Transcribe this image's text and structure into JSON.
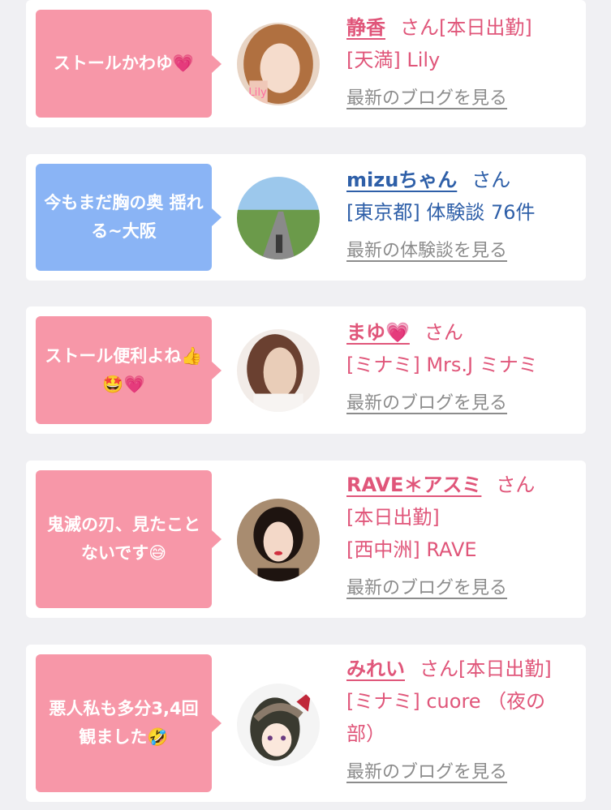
{
  "cards": [
    {
      "message": "ストールかわゆ💗",
      "name": "静香",
      "san": "さん[本日出勤]",
      "lines": [
        "[天満] Lily"
      ],
      "link": "最新のブログを見る",
      "color": "#f797a8"
    },
    {
      "message": "今もまだ胸の奥 揺れる~大阪",
      "name": "mizuちゃん",
      "san": "さん",
      "lines": [
        "[東京都] 体験談 76件"
      ],
      "link": "最新の体験談を見る",
      "color": "#8ab4f5"
    },
    {
      "message": "ストール便利よね👍🤩💗",
      "name": "まゆ💗",
      "san": "さん",
      "lines": [
        "[ミナミ] Mrs.J ミナミ"
      ],
      "link": "最新のブログを見る",
      "color": "#f797a8"
    },
    {
      "message": "鬼滅の刃、見たことないです😅",
      "name": "RAVE＊アスミ",
      "san": "さん",
      "lines": [
        "[本日出勤]",
        "[西中洲] RAVE"
      ],
      "link": "最新のブログを見る",
      "color": "#f797a8"
    },
    {
      "message": "悪人私も多分3,4回観ました🤣",
      "name": "みれい",
      "san": "さん[本日出勤]",
      "lines": [
        "[ミナミ] cuore （夜の",
        "部）"
      ],
      "link": "最新のブログを見る",
      "color": "#f797a8"
    }
  ]
}
